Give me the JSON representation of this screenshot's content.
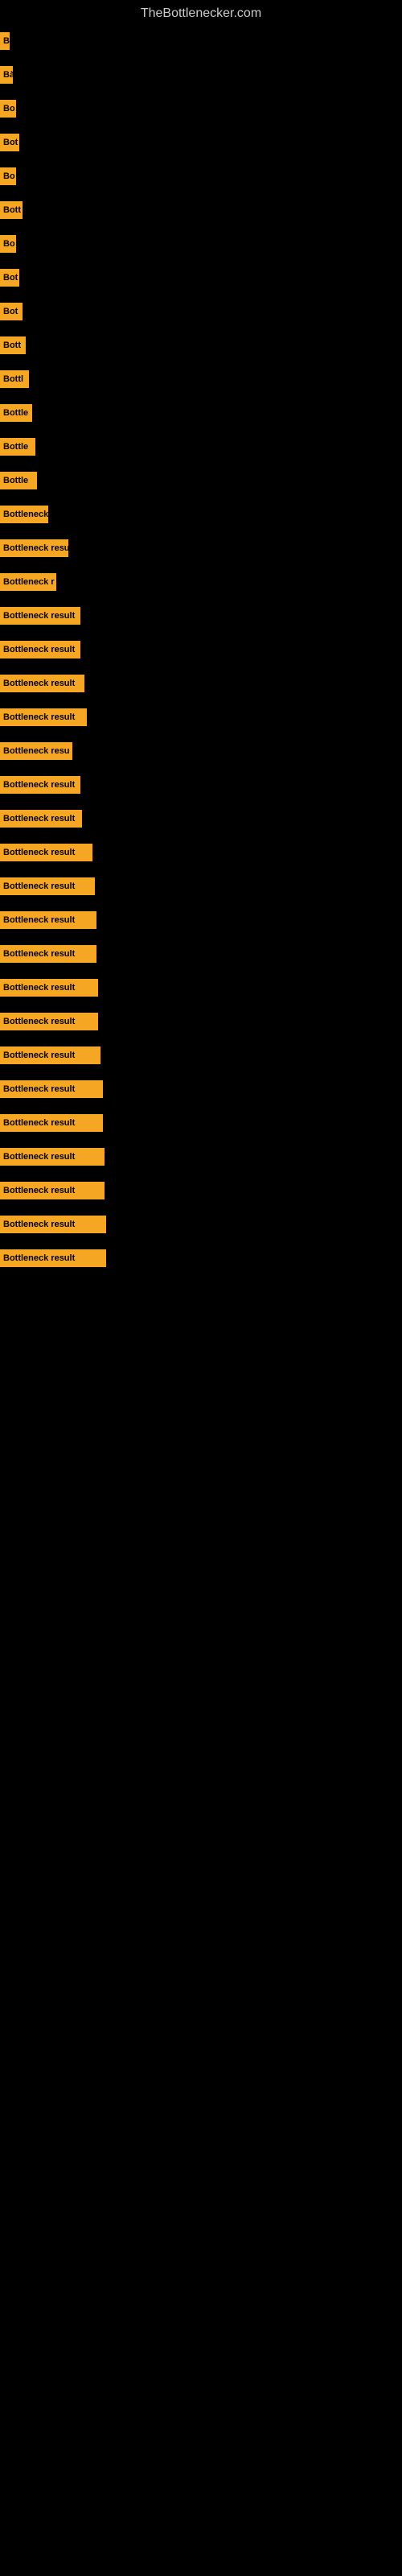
{
  "site": {
    "title": "TheBottlenecker.com"
  },
  "bars": [
    {
      "label": "B",
      "width": 12
    },
    {
      "label": "Bà",
      "width": 16
    },
    {
      "label": "Bo",
      "width": 20
    },
    {
      "label": "Bot",
      "width": 24
    },
    {
      "label": "Bo",
      "width": 20
    },
    {
      "label": "Bott",
      "width": 28
    },
    {
      "label": "Bo",
      "width": 20
    },
    {
      "label": "Bot",
      "width": 24
    },
    {
      "label": "Bot",
      "width": 28
    },
    {
      "label": "Bott",
      "width": 32
    },
    {
      "label": "Bottl",
      "width": 36
    },
    {
      "label": "Bottle",
      "width": 40
    },
    {
      "label": "Bottle",
      "width": 44
    },
    {
      "label": "Bottle",
      "width": 46
    },
    {
      "label": "Bottleneck",
      "width": 60
    },
    {
      "label": "Bottleneck resu",
      "width": 85
    },
    {
      "label": "Bottleneck r",
      "width": 70
    },
    {
      "label": "Bottleneck result",
      "width": 100
    },
    {
      "label": "Bottleneck result",
      "width": 100
    },
    {
      "label": "Bottleneck result",
      "width": 105
    },
    {
      "label": "Bottleneck result",
      "width": 108
    },
    {
      "label": "Bottleneck resu",
      "width": 90
    },
    {
      "label": "Bottleneck result",
      "width": 100
    },
    {
      "label": "Bottleneck result",
      "width": 102
    },
    {
      "label": "Bottleneck result",
      "width": 115
    },
    {
      "label": "Bottleneck result",
      "width": 118
    },
    {
      "label": "Bottleneck result",
      "width": 120
    },
    {
      "label": "Bottleneck result",
      "width": 120
    },
    {
      "label": "Bottleneck result",
      "width": 122
    },
    {
      "label": "Bottleneck result",
      "width": 122
    },
    {
      "label": "Bottleneck result",
      "width": 125
    },
    {
      "label": "Bottleneck result",
      "width": 128
    },
    {
      "label": "Bottleneck result",
      "width": 128
    },
    {
      "label": "Bottleneck result",
      "width": 130
    },
    {
      "label": "Bottleneck result",
      "width": 130
    },
    {
      "label": "Bottleneck result",
      "width": 132
    },
    {
      "label": "Bottleneck result",
      "width": 132
    }
  ]
}
